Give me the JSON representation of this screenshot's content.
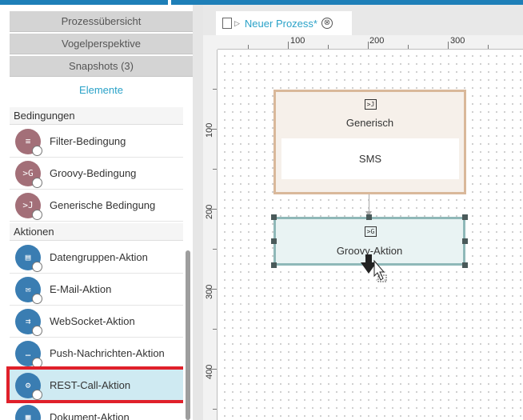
{
  "left_panel": {
    "accordions": [
      {
        "label": "Prozessübersicht"
      },
      {
        "label": "Vogelperspektive"
      },
      {
        "label": "Snapshots (3)"
      }
    ],
    "active_accordion": "Elemente",
    "sections": {
      "conditions": {
        "title": "Bedingungen",
        "items": [
          {
            "label": "Filter-Bedingung",
            "icon": "filter-condition-icon"
          },
          {
            "label": "Groovy-Bedingung",
            "icon": "groovy-condition-icon"
          },
          {
            "label": "Generische Bedingung",
            "icon": "generic-condition-icon"
          }
        ]
      },
      "actions": {
        "title": "Aktionen",
        "items": [
          {
            "label": "Datengruppen-Aktion",
            "icon": "database-action-icon"
          },
          {
            "label": "E-Mail-Aktion",
            "icon": "email-action-icon"
          },
          {
            "label": "WebSocket-Aktion",
            "icon": "websocket-action-icon"
          },
          {
            "label": "Push-Nachrichten-Aktion",
            "icon": "push-message-action-icon"
          },
          {
            "label": "REST-Call-Aktion",
            "icon": "rest-call-action-icon"
          },
          {
            "label": "Dokument-Aktion",
            "icon": "document-action-icon"
          }
        ]
      }
    }
  },
  "tab": {
    "title": "Neuer Prozess*",
    "close_glyph": "⊗"
  },
  "rulers": {
    "horizontal": [
      "100",
      "200",
      "300"
    ],
    "vertical": [
      "100",
      "200",
      "300",
      "400"
    ]
  },
  "canvas": {
    "generic_node": {
      "icon_glyph": ">J",
      "name": "Generisch",
      "inner_label": "SMS"
    },
    "groovy_node": {
      "icon_glyph": ">G",
      "name": "Groovy-Aktion"
    }
  },
  "colors": {
    "accent": "#2aa2c8",
    "condition_icon": "#a36f78",
    "action_icon": "#3a7db2",
    "highlight_border": "#e0202a",
    "selected_row": "#cfeaf2"
  }
}
